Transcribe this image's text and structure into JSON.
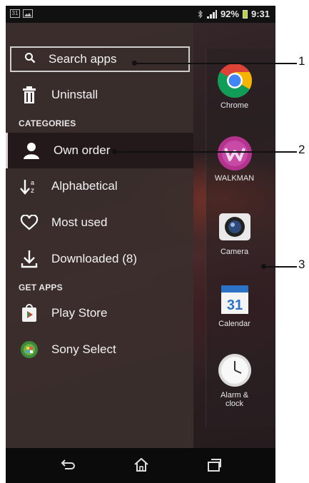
{
  "status": {
    "left_icons": [
      "31",
      "gallery-icon"
    ],
    "battery": "92%",
    "time": "9:31"
  },
  "drawer": {
    "search_label": "Search apps",
    "uninstall_label": "Uninstall",
    "categories_header": "CATEGORIES",
    "categories": [
      {
        "label": "Own order",
        "icon": "person-icon",
        "selected": true
      },
      {
        "label": "Alphabetical",
        "icon": "alphabetical-sort-icon"
      },
      {
        "label": "Most used",
        "icon": "heart-icon"
      },
      {
        "label": "Downloaded (8)",
        "icon": "download-icon"
      }
    ],
    "get_apps_header": "GET APPS",
    "get_apps": [
      {
        "label": "Play Store",
        "icon": "play-store-icon"
      },
      {
        "label": "Sony Select",
        "icon": "sony-select-icon"
      }
    ]
  },
  "apps": [
    {
      "label": "Chrome",
      "icon": "chrome-icon"
    },
    {
      "label": "WALKMAN",
      "icon": "walkman-icon"
    },
    {
      "label": "Camera",
      "icon": "camera-icon"
    },
    {
      "label": "Calendar",
      "icon": "calendar-icon",
      "badge": "31"
    },
    {
      "label": "Alarm & clock",
      "icon": "clock-icon"
    }
  ],
  "callouts": [
    "1",
    "2",
    "3"
  ],
  "colors": {
    "accent_calendar": "#2c72c7",
    "drawer_bg": "#3a2e2c"
  }
}
